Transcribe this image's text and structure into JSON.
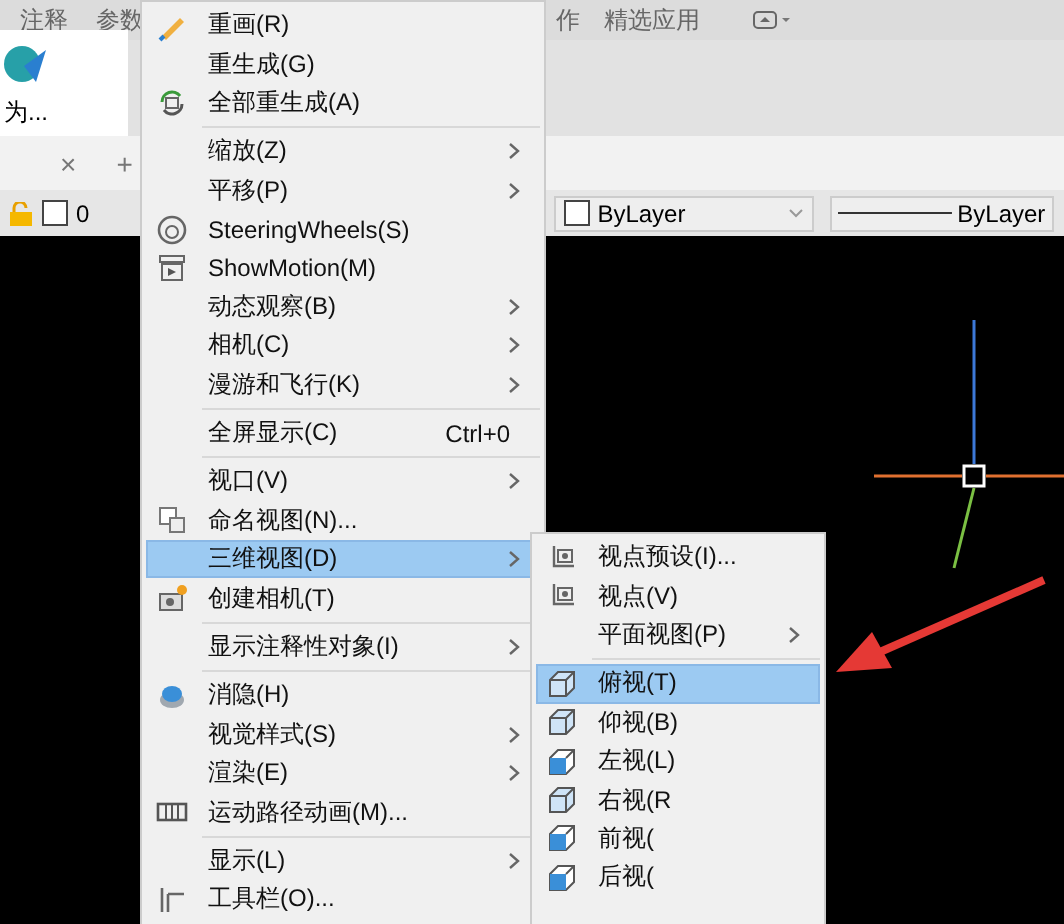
{
  "ribbon": {
    "tabs": [
      {
        "label": "注释"
      },
      {
        "label": "参数"
      },
      {
        "label": "作"
      },
      {
        "label": "精选应用"
      }
    ]
  },
  "file_tab": {
    "thumbnail_label": "为...",
    "close": "×",
    "new_tab": "+"
  },
  "layer_bar": {
    "layer": "0",
    "color_setting": "ByLayer",
    "linetype": "ByLayer"
  },
  "menu": {
    "items": [
      {
        "kind": "item",
        "label": "重画(R)",
        "selected": false
      },
      {
        "kind": "item",
        "label": "重生成(G)",
        "selected": false
      },
      {
        "kind": "item",
        "label": "全部重生成(A)",
        "selected": false
      },
      {
        "kind": "separator"
      },
      {
        "kind": "item",
        "label": "缩放(Z)",
        "submenu": true,
        "selected": false
      },
      {
        "kind": "item",
        "label": "平移(P)",
        "submenu": true,
        "selected": false
      },
      {
        "kind": "item",
        "label": "SteeringWheels(S)",
        "selected": false
      },
      {
        "kind": "item",
        "label": "ShowMotion(M)",
        "selected": false
      },
      {
        "kind": "item",
        "label": "动态观察(B)",
        "submenu": true,
        "selected": false
      },
      {
        "kind": "item",
        "label": "相机(C)",
        "submenu": true,
        "selected": false
      },
      {
        "kind": "item",
        "label": "漫游和飞行(K)",
        "submenu": true,
        "selected": false
      },
      {
        "kind": "separator"
      },
      {
        "kind": "item",
        "label": "全屏显示(C)",
        "shortcut": "Ctrl+0",
        "selected": false
      },
      {
        "kind": "separator"
      },
      {
        "kind": "item",
        "label": "视口(V)",
        "submenu": true,
        "selected": false
      },
      {
        "kind": "item",
        "label": "命名视图(N)...",
        "selected": false
      },
      {
        "kind": "item",
        "label": "三维视图(D)",
        "submenu": true,
        "selected": true
      },
      {
        "kind": "item",
        "label": "创建相机(T)",
        "selected": false
      },
      {
        "kind": "separator"
      },
      {
        "kind": "item",
        "label": "显示注释性对象(I)",
        "submenu": true,
        "selected": false
      },
      {
        "kind": "separator"
      },
      {
        "kind": "item",
        "label": "消隐(H)",
        "selected": false
      },
      {
        "kind": "item",
        "label": "视觉样式(S)",
        "submenu": true,
        "selected": false
      },
      {
        "kind": "item",
        "label": "渲染(E)",
        "submenu": true,
        "selected": false
      },
      {
        "kind": "item",
        "label": "运动路径动画(M)...",
        "selected": false
      },
      {
        "kind": "separator"
      },
      {
        "kind": "item",
        "label": "显示(L)",
        "submenu": true,
        "selected": false
      },
      {
        "kind": "item",
        "label": "工具栏(O)...",
        "selected": false
      }
    ]
  },
  "submenu": {
    "items": [
      {
        "kind": "item",
        "label": "视点预设(I)...",
        "selected": false
      },
      {
        "kind": "item",
        "label": "视点(V)",
        "selected": false
      },
      {
        "kind": "item",
        "label": "平面视图(P)",
        "submenu": true,
        "selected": false
      },
      {
        "kind": "separator"
      },
      {
        "kind": "item",
        "label": "俯视(T)",
        "selected": true
      },
      {
        "kind": "item",
        "label": "仰视(B)",
        "selected": false
      },
      {
        "kind": "item",
        "label": "左视(L)",
        "selected": false
      },
      {
        "kind": "item",
        "label": "右视(R",
        "selected": false
      },
      {
        "kind": "item",
        "label": "前视(",
        "selected": false
      },
      {
        "kind": "item",
        "label": "后视(",
        "selected": false
      }
    ]
  }
}
